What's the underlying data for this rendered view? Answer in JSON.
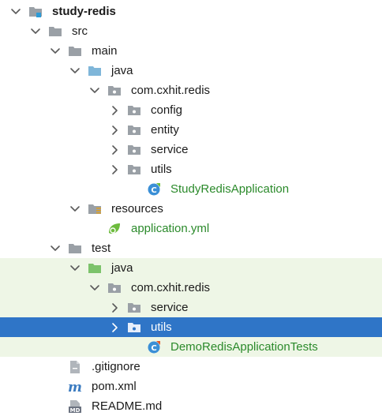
{
  "tree": [
    {
      "label": "study-redis",
      "depth": 0,
      "chevron": "down",
      "icon": "module-folder-icon",
      "bold": true
    },
    {
      "label": "src",
      "depth": 1,
      "chevron": "down",
      "icon": "folder-icon"
    },
    {
      "label": "main",
      "depth": 2,
      "chevron": "down",
      "icon": "folder-icon"
    },
    {
      "label": "java",
      "depth": 3,
      "chevron": "down",
      "icon": "source-root-folder-icon"
    },
    {
      "label": "com.cxhit.redis",
      "depth": 4,
      "chevron": "down",
      "icon": "package-icon"
    },
    {
      "label": "config",
      "depth": 5,
      "chevron": "right",
      "icon": "package-icon"
    },
    {
      "label": "entity",
      "depth": 5,
      "chevron": "right",
      "icon": "package-icon"
    },
    {
      "label": "service",
      "depth": 5,
      "chevron": "right",
      "icon": "package-icon"
    },
    {
      "label": "utils",
      "depth": 5,
      "chevron": "right",
      "icon": "package-icon"
    },
    {
      "label": "StudyRedisApplication",
      "depth": 6,
      "chevron": "none",
      "icon": "spring-class-icon",
      "green": true
    },
    {
      "label": "resources",
      "depth": 3,
      "chevron": "down",
      "icon": "resources-folder-icon"
    },
    {
      "label": "application.yml",
      "depth": 4,
      "chevron": "none",
      "icon": "spring-config-icon",
      "green": true
    },
    {
      "label": "test",
      "depth": 2,
      "chevron": "down",
      "icon": "folder-icon"
    },
    {
      "label": "java",
      "depth": 3,
      "chevron": "down",
      "icon": "test-root-folder-icon",
      "test": true
    },
    {
      "label": "com.cxhit.redis",
      "depth": 4,
      "chevron": "down",
      "icon": "package-icon",
      "test": true
    },
    {
      "label": "service",
      "depth": 5,
      "chevron": "right",
      "icon": "package-icon",
      "test": true
    },
    {
      "label": "utils",
      "depth": 5,
      "chevron": "right",
      "icon": "package-icon",
      "test": true,
      "selected": true
    },
    {
      "label": "DemoRedisApplicationTests",
      "depth": 6,
      "chevron": "none",
      "icon": "spring-test-class-icon",
      "green": true,
      "test": true
    },
    {
      "label": ".gitignore",
      "depth": 2,
      "chevron": "none",
      "icon": "gitignore-file-icon"
    },
    {
      "label": "pom.xml",
      "depth": 2,
      "chevron": "none",
      "icon": "maven-file-icon"
    },
    {
      "label": "README.md",
      "depth": 2,
      "chevron": "none",
      "icon": "markdown-file-icon"
    }
  ],
  "icon_badge_text": "MD",
  "colors": {
    "selection": "#2f75c7",
    "test_background": "#eef6e6",
    "green_text": "#2b8a2b",
    "folder_gray": "#9aa0a6",
    "source_root_blue": "#7fb6d9",
    "test_root_green": "#7cc36b"
  }
}
